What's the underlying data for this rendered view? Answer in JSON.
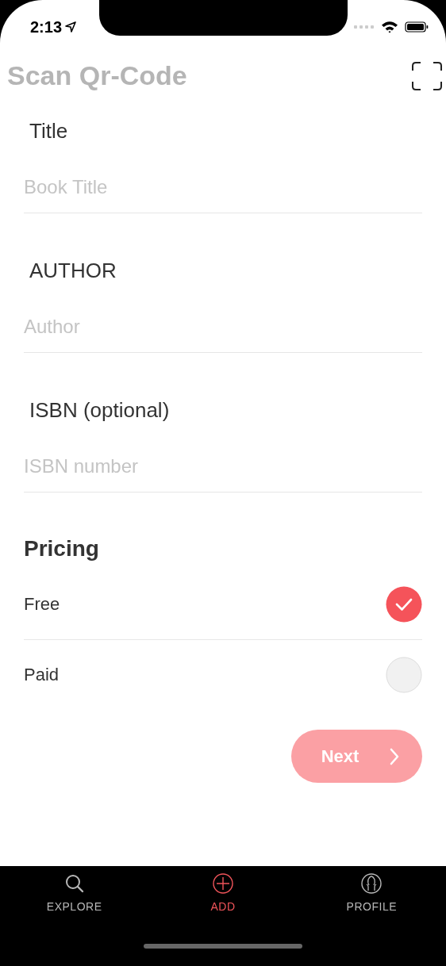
{
  "status_bar": {
    "time": "2:13"
  },
  "header": {
    "title": "Scan Qr-Code"
  },
  "fields": [
    {
      "label": "Title",
      "placeholder": "Book Title"
    },
    {
      "label": "AUTHOR",
      "placeholder": "Author"
    },
    {
      "label": "ISBN (optional)",
      "placeholder": "ISBN number"
    }
  ],
  "pricing": {
    "heading": "Pricing",
    "options": [
      {
        "label": "Free",
        "selected": true
      },
      {
        "label": "Paid",
        "selected": false
      }
    ]
  },
  "next_button": {
    "label": "Next"
  },
  "tabs": [
    {
      "label": "EXPLORE",
      "kind": "search",
      "selected": false
    },
    {
      "label": "ADD",
      "kind": "add",
      "selected": true
    },
    {
      "label": "PROFILE",
      "kind": "profile",
      "selected": false
    }
  ]
}
